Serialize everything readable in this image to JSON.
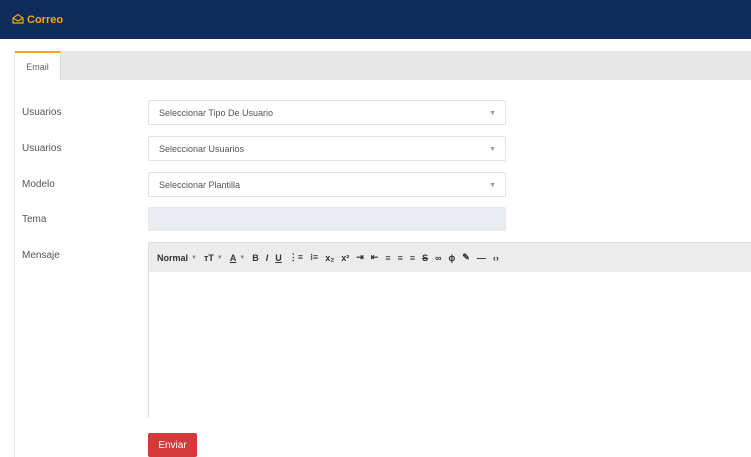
{
  "header": {
    "app_title": "Correo",
    "icon": "mail-open-icon"
  },
  "tabs": [
    {
      "label": "Email",
      "active": true
    }
  ],
  "form": {
    "user_type_label": "Usuarios",
    "user_type_placeholder": "Seleccionar Tipo De Usuario",
    "users_label": "Usuarios",
    "users_placeholder": "Seleccionar Usuarios",
    "model_label": "Modelo",
    "model_placeholder": "Seleccionar Plantilla",
    "subject_label": "Tema",
    "subject_value": "",
    "message_label": "Mensaje",
    "message_value": ""
  },
  "editor": {
    "heading_select": "Normal",
    "tools": [
      "font-size-icon",
      "text-color-icon",
      "bold-icon",
      "italic-icon",
      "underline-icon",
      "ordered-list-icon",
      "unordered-list-icon",
      "subscript-icon",
      "superscript-icon",
      "indent-icon",
      "outdent-icon",
      "align-left-icon",
      "align-center-icon",
      "align-right-icon",
      "strikethrough-icon",
      "link-icon",
      "unlink-icon",
      "highlight-icon",
      "horizontal-rule-icon",
      "code-view-icon"
    ]
  },
  "actions": {
    "send_label": "Enviar"
  },
  "colors": {
    "header_bg": "#0f2b5b",
    "accent": "#f2a615",
    "send_button": "#d43a3a",
    "toolbar_bg": "#ececec"
  }
}
